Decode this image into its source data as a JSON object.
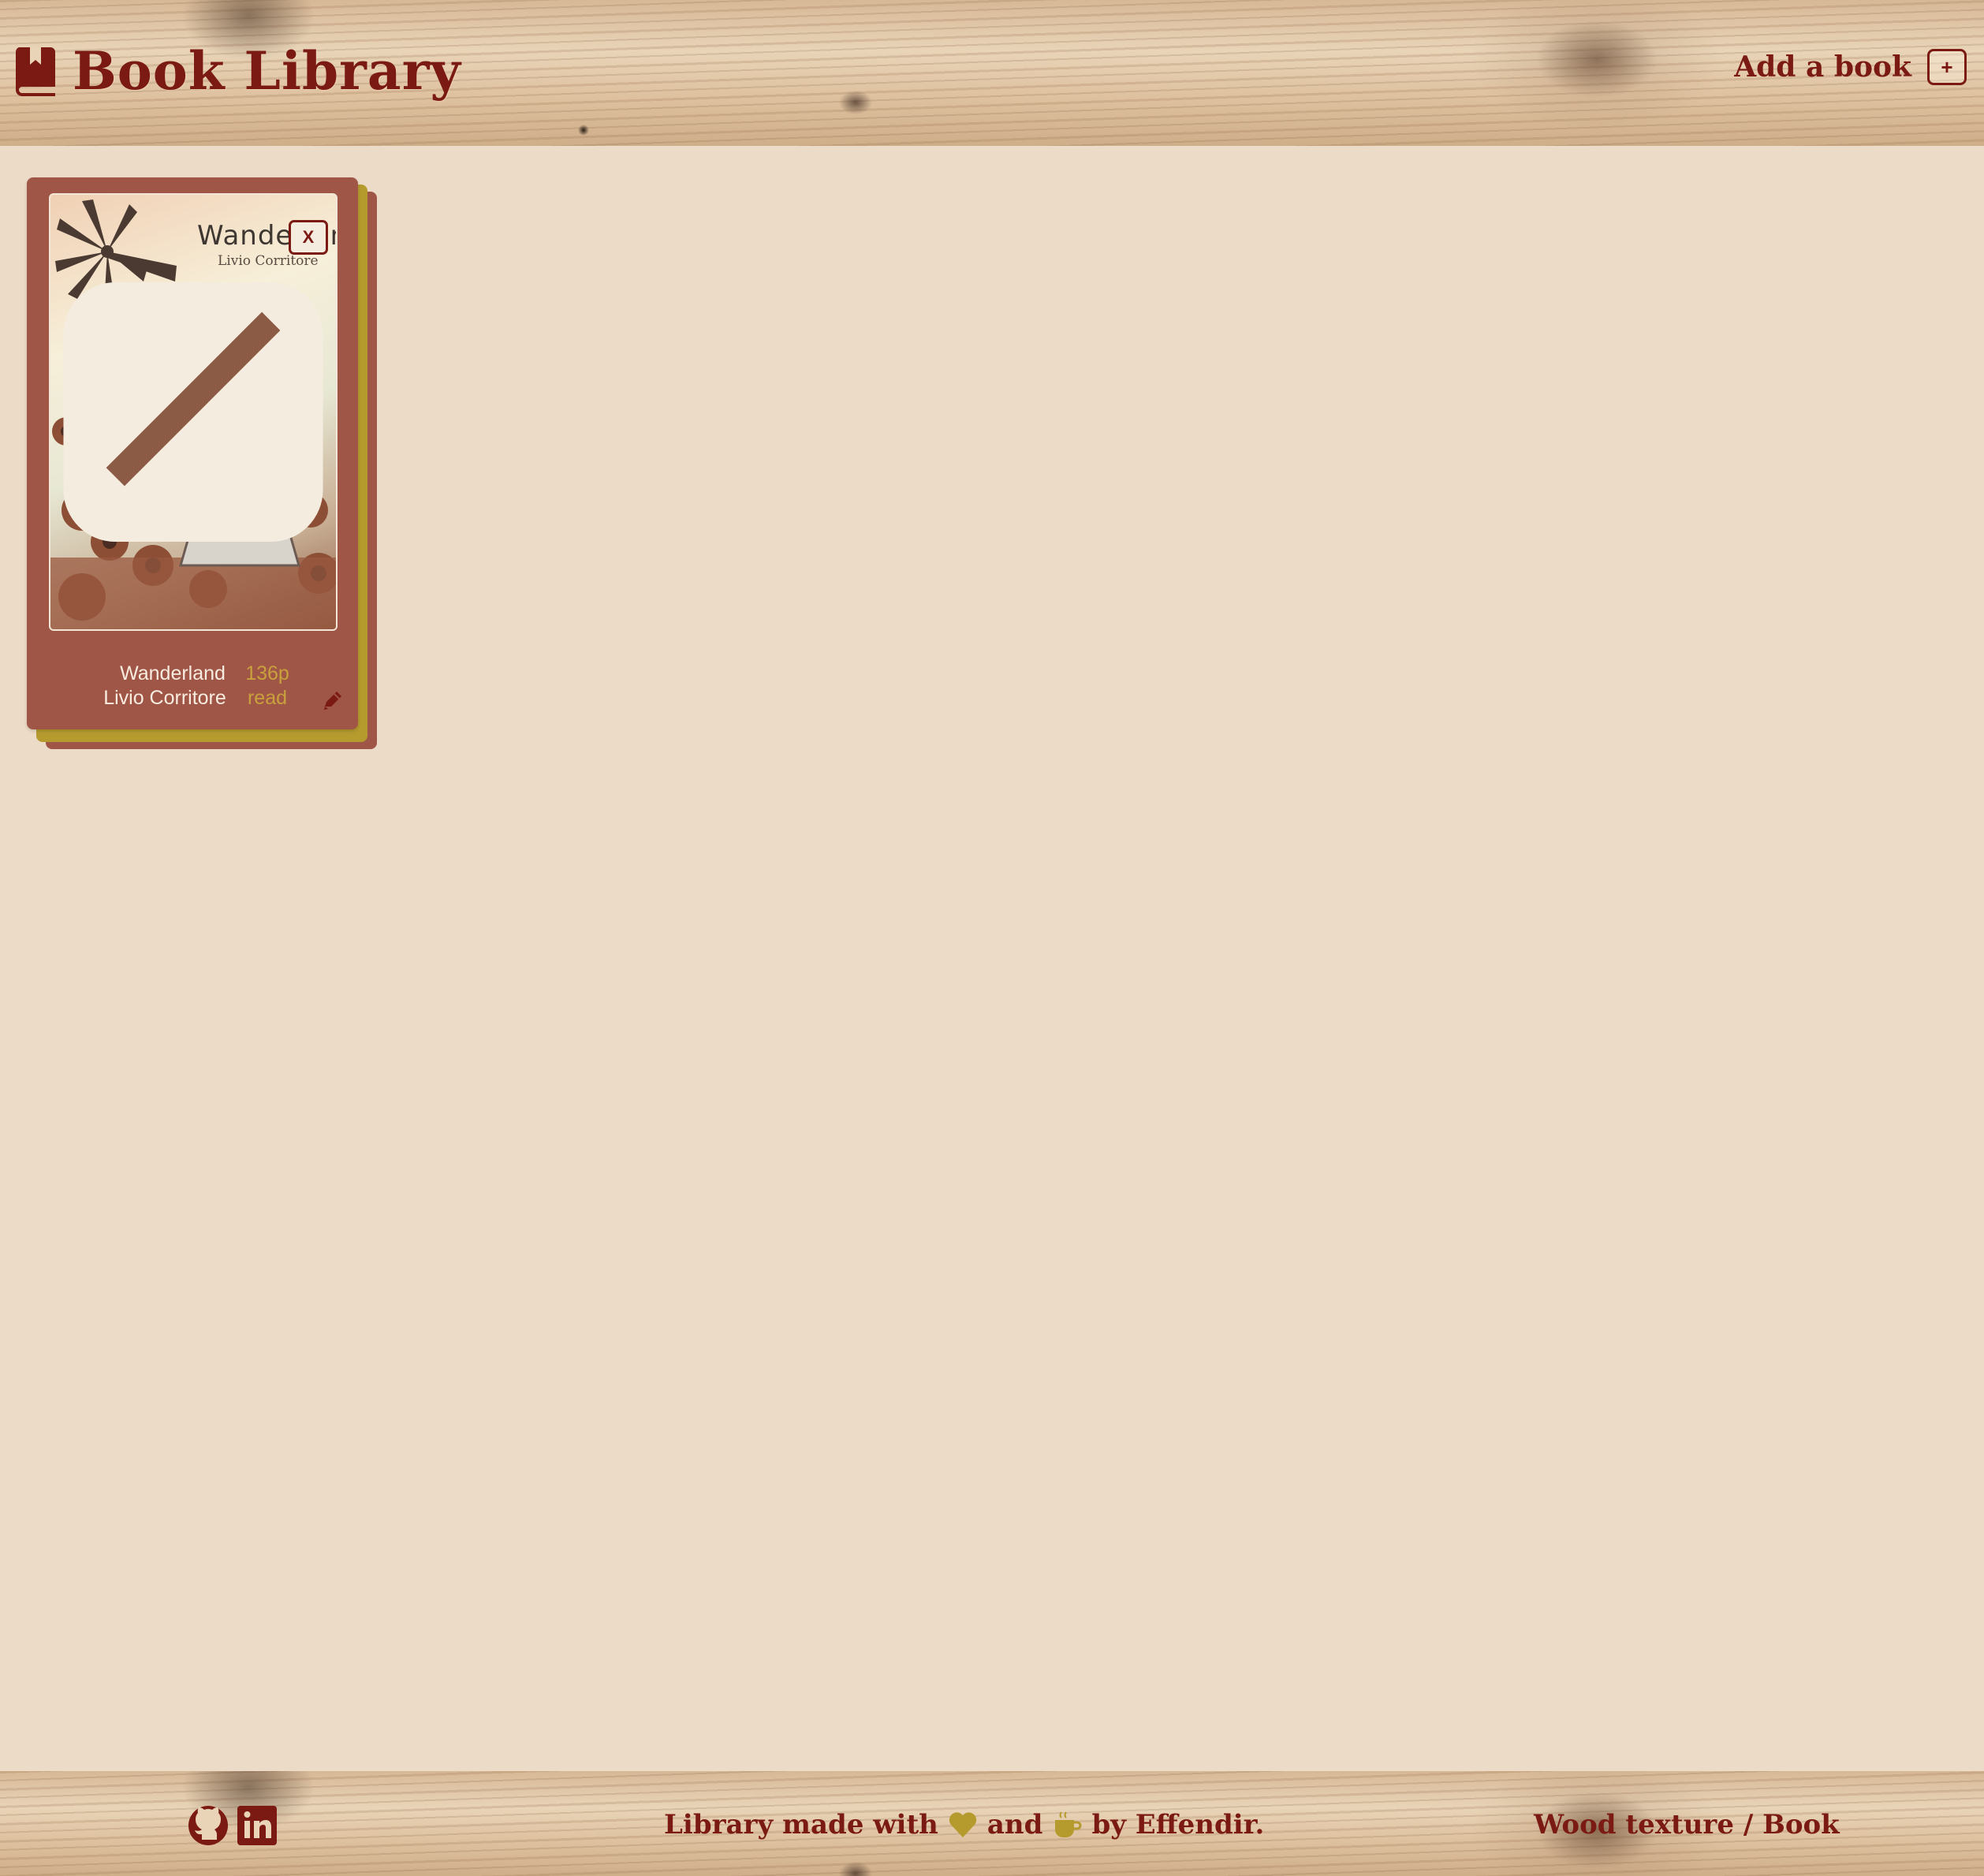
{
  "header": {
    "title": "Book Library",
    "add_label": "Add a book",
    "add_button": "+"
  },
  "books": [
    {
      "title": "Wanderland",
      "author": "Livio Corritore",
      "pages": "136p",
      "status": "read",
      "remove_label": "X",
      "cover_title": "Wanderland",
      "cover_author": "Livio Corritore"
    }
  ],
  "footer": {
    "made_with": "Library made with",
    "and": "and",
    "by": "by Effendir.",
    "credit_wood": "Wood texture",
    "credit_sep": "/",
    "credit_book": "Book"
  },
  "icons": {
    "brand": "book-icon",
    "remove": "close-icon",
    "edit": "pencil-icon",
    "read_badge": "checkbox-icon",
    "github": "github-icon",
    "linkedin": "linkedin-icon",
    "heart": "heart-icon",
    "coffee": "coffee-icon"
  },
  "colors": {
    "accent": "#7a1a12",
    "card": "#a05647",
    "gold": "#b59a2e",
    "background": "#ecdbc6"
  }
}
